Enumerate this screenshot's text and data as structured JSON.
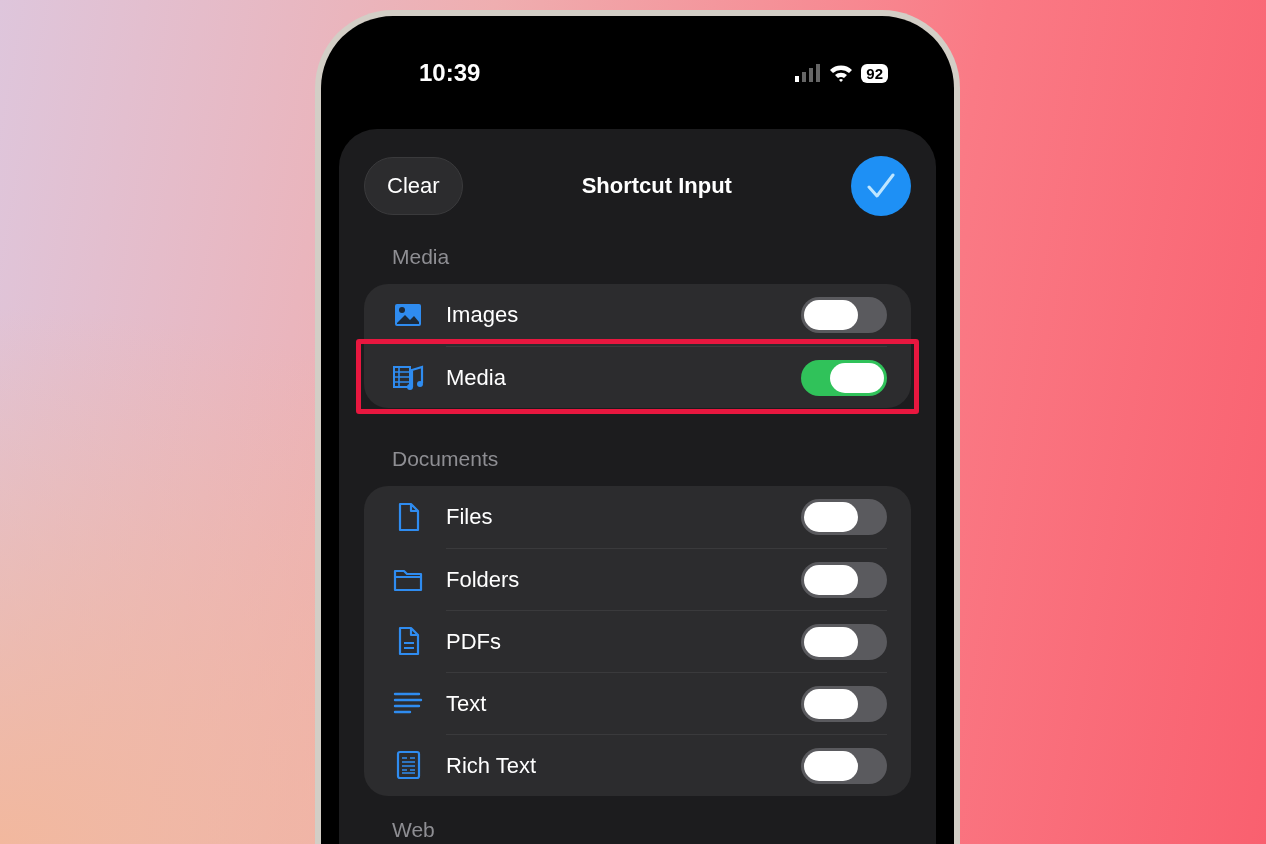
{
  "status_bar": {
    "time": "10:39",
    "battery": "92"
  },
  "sheet": {
    "clear_button": "Clear",
    "title": "Shortcut Input",
    "done_selected": true
  },
  "sections": [
    {
      "header": "Media",
      "items": [
        {
          "label": "Images",
          "on": false,
          "highlighted": false
        },
        {
          "label": "Media",
          "on": true,
          "highlighted": true
        }
      ]
    },
    {
      "header": "Documents",
      "items": [
        {
          "label": "Files",
          "on": false,
          "highlighted": false
        },
        {
          "label": "Folders",
          "on": false,
          "highlighted": false
        },
        {
          "label": "PDFs",
          "on": false,
          "highlighted": false
        },
        {
          "label": "Text",
          "on": false,
          "highlighted": false
        },
        {
          "label": "Rich Text",
          "on": false,
          "highlighted": false
        }
      ]
    },
    {
      "header": "Web"
    }
  ]
}
